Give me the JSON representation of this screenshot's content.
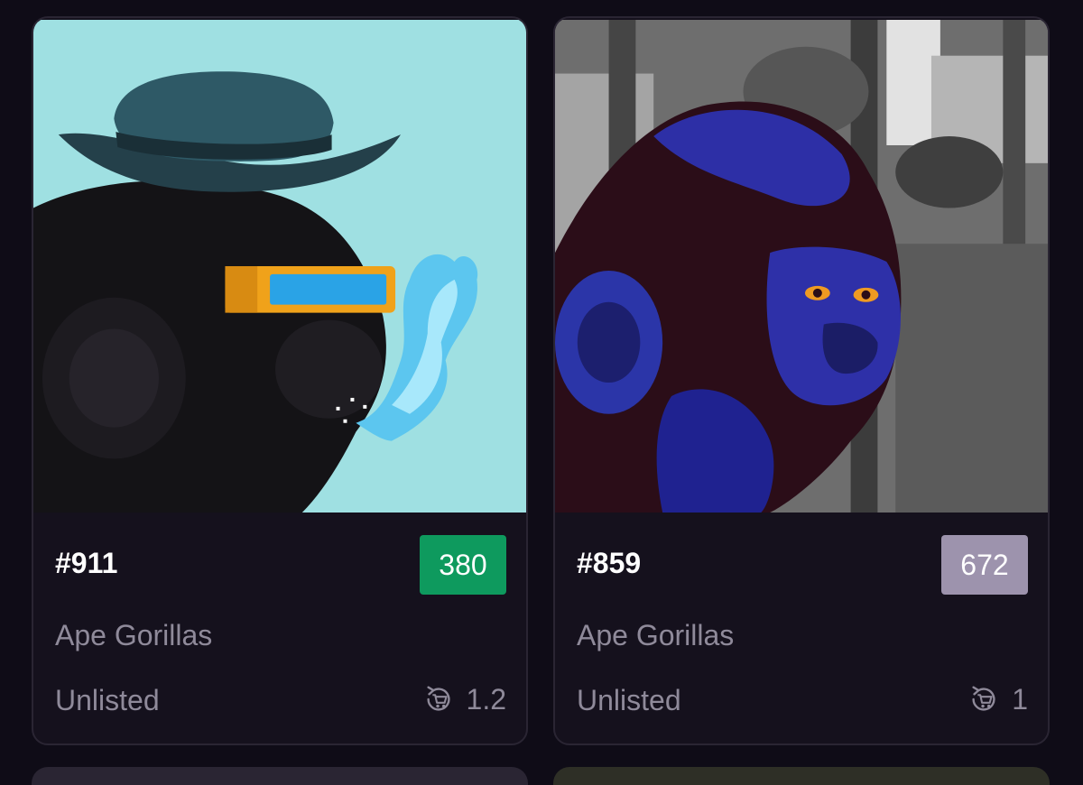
{
  "cards": [
    {
      "token_id": "#911",
      "rank": "380",
      "rank_color": "#0e9a5e",
      "collection": "Ape Gorillas",
      "status": "Unlisted",
      "price": "1.2",
      "art_description_icon": "gorilla-bowler-hat-visor-nft-image"
    },
    {
      "token_id": "#859",
      "rank": "672",
      "rank_color": "#9d93ad",
      "collection": "Ape Gorillas",
      "status": "Unlisted",
      "price": "1",
      "art_description_icon": "gorilla-forest-nft-image"
    }
  ],
  "colors": {
    "page_bg": "#0f0c17",
    "card_bg": "#15111d",
    "muted_text": "#8f8a9a"
  }
}
